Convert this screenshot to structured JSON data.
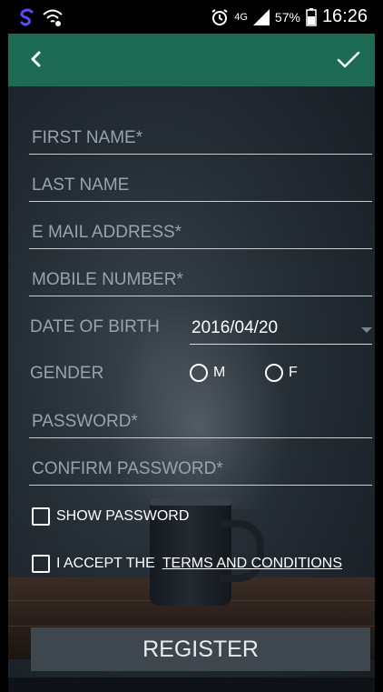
{
  "status_bar": {
    "app_icon": "s-logo-icon",
    "wifi_icon": "wifi-icon",
    "alarm_icon": "alarm-icon",
    "network_label": "4G",
    "signal_icon": "signal-icon",
    "battery_percent": "57%",
    "battery_icon": "battery-icon",
    "time": "16:26"
  },
  "toolbar": {
    "back_icon": "chevron-left-icon",
    "confirm_icon": "check-icon",
    "background_color": "#1e6b55"
  },
  "form": {
    "first_name_placeholder": "FIRST NAME*",
    "last_name_placeholder": "LAST NAME",
    "email_placeholder": "E MAIL ADDRESS*",
    "mobile_placeholder": "MOBILE NUMBER*",
    "dob_label": "DATE OF BIRTH",
    "dob_value": "2016/04/20",
    "gender_label": "GENDER",
    "gender_options": [
      "M",
      "F"
    ],
    "password_placeholder": "PASSWORD*",
    "confirm_password_placeholder": "CONFIRM PASSWORD*",
    "show_password_label": "SHOW PASSWORD",
    "accept_label": "I ACCEPT THE",
    "terms_link": "TERMS AND CONDITIONS",
    "register_label": "REGISTER"
  }
}
